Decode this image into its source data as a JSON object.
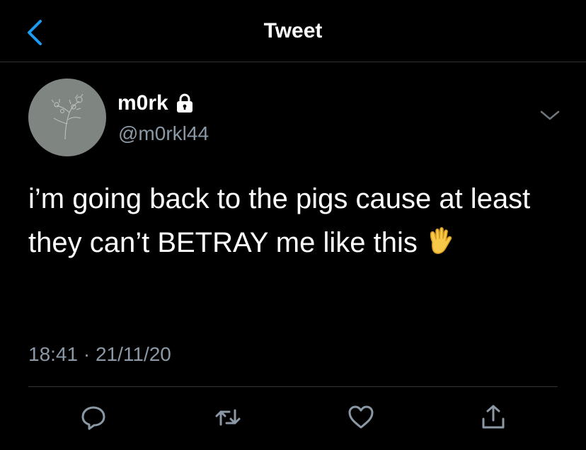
{
  "header": {
    "title": "Tweet",
    "back_icon": "chevron-left-icon"
  },
  "tweet": {
    "author": {
      "display_name": "m0rk",
      "handle": "@m0rkl44",
      "protected_icon": "lock-icon",
      "avatar_icon": "flower-sketch-avatar"
    },
    "text": "i’m going back to the pigs cause at least they can’t BETRAY me like this",
    "emoji": "raised-hand-emoji",
    "timestamp": "18:41 · 21/11/20"
  },
  "actions": [
    {
      "name": "reply",
      "icon": "reply-icon"
    },
    {
      "name": "retweet",
      "icon": "retweet-icon"
    },
    {
      "name": "like",
      "icon": "heart-icon"
    },
    {
      "name": "share",
      "icon": "share-icon"
    }
  ],
  "colors": {
    "background": "#000000",
    "accent": "#1d9bf0",
    "secondary_text": "#8b98a5",
    "divider": "#2f3336",
    "avatar_bg": "#7f8681"
  }
}
